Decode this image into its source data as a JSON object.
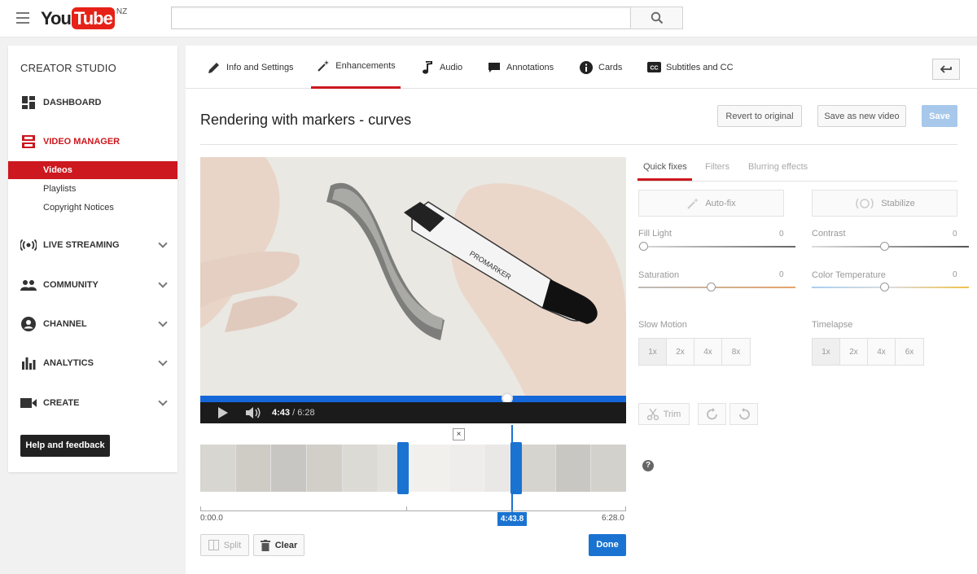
{
  "header": {
    "logo_you": "You",
    "logo_tube": "Tube",
    "logo_region": "NZ",
    "search_placeholder": ""
  },
  "sidebar": {
    "title": "CREATOR STUDIO",
    "items": [
      {
        "label": "DASHBOARD",
        "icon": "dashboard-icon"
      },
      {
        "label": "VIDEO MANAGER",
        "icon": "video-manager-icon",
        "active": true
      },
      {
        "label": "LIVE STREAMING",
        "icon": "live-streaming-icon"
      },
      {
        "label": "COMMUNITY",
        "icon": "community-icon"
      },
      {
        "label": "CHANNEL",
        "icon": "channel-icon"
      },
      {
        "label": "ANALYTICS",
        "icon": "analytics-icon"
      },
      {
        "label": "CREATE",
        "icon": "create-icon"
      }
    ],
    "subitems": [
      "Videos",
      "Playlists",
      "Copyright Notices"
    ],
    "help_label": "Help and feedback"
  },
  "tabs": [
    {
      "label": "Info and Settings",
      "icon": "pencil-icon"
    },
    {
      "label": "Enhancements",
      "icon": "magic-wand-icon",
      "active": true
    },
    {
      "label": "Audio",
      "icon": "music-note-icon"
    },
    {
      "label": "Annotations",
      "icon": "speech-bubble-icon"
    },
    {
      "label": "Cards",
      "icon": "info-icon"
    },
    {
      "label": "Subtitles and CC",
      "icon": "cc-icon"
    }
  ],
  "video": {
    "title": "Rendering with markers - curves",
    "revert_label": "Revert to original",
    "save_new_label": "Save as new video",
    "save_label": "Save",
    "current_time": "4:43",
    "separator": " / ",
    "duration": "6:28",
    "progress": 0.73
  },
  "timeline": {
    "start": "0:00.0",
    "end": "6:28.0",
    "current": "4:43.8",
    "close_label": "×",
    "split_label": "Split",
    "clear_label": "Clear",
    "done_label": "Done"
  },
  "enhance": {
    "tabs": [
      "Quick fixes",
      "Filters",
      "Blurring effects"
    ],
    "autofix_label": "Auto-fix",
    "stabilize_label": "Stabilize",
    "sliders": [
      {
        "label": "Fill Light",
        "value": "0"
      },
      {
        "label": "Contrast",
        "value": "0"
      },
      {
        "label": "Saturation",
        "value": "0"
      },
      {
        "label": "Color Temperature",
        "value": "0"
      }
    ],
    "slow_motion_label": "Slow Motion",
    "slow_motion_options": [
      "1x",
      "2x",
      "4x",
      "8x"
    ],
    "timelapse_label": "Timelapse",
    "timelapse_options": [
      "1x",
      "2x",
      "4x",
      "6x"
    ],
    "trim_label": "Trim",
    "help_mark": "?"
  },
  "colors": {
    "brand_red": "#cc181e",
    "accent_blue": "#1a73d1"
  }
}
